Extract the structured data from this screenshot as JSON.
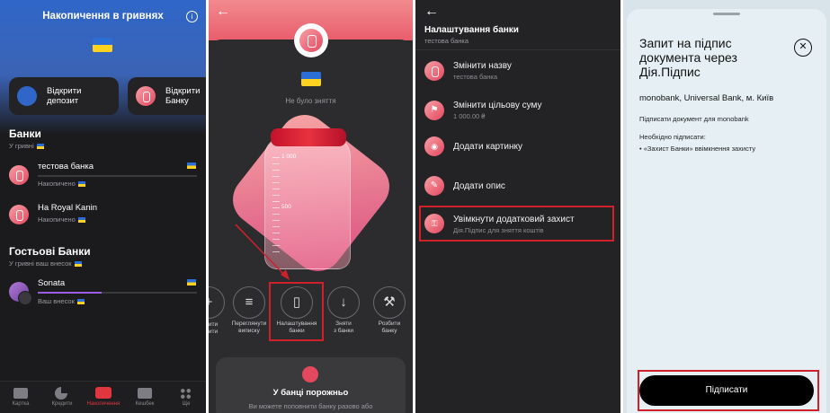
{
  "colors": {
    "accent_blue": "#2f66c8",
    "pink": "#e3485e",
    "red_highlight": "#d0202a",
    "dark": "#1b1b1d"
  },
  "screen1": {
    "header_title": "Накопичення в гривнях",
    "info_icon": "info-icon",
    "actions": [
      {
        "label": "Відкрити депозит",
        "icon": "deposit-icon"
      },
      {
        "label": "Відкрити Банку",
        "icon": "jar-icon"
      }
    ],
    "banks_title": "Банки",
    "banks_subtitle": "У гривні",
    "banks": [
      {
        "name": "тестова банка",
        "status": "Накопичено"
      },
      {
        "name": "На Royal Kanin",
        "status": "Накопичено"
      }
    ],
    "guest_title": "Гостьові Банки",
    "guest_subtitle": "У гривні ваш внесок",
    "guest_banks": [
      {
        "name": "Sonata",
        "status": "Ваш внесок",
        "progress": 0.4
      }
    ],
    "bottom_nav": [
      {
        "label": "Картка",
        "icon": "card-icon"
      },
      {
        "label": "Кредити",
        "icon": "pie-chart-icon"
      },
      {
        "label": "Накопичення",
        "icon": "savings-icon",
        "active": true
      },
      {
        "label": "Кешбек",
        "icon": "gift-icon"
      },
      {
        "label": "Ще",
        "icon": "more-icon"
      }
    ]
  },
  "screen2": {
    "back_icon": "back-arrow-icon",
    "status_text": "Не було зняття",
    "jar_marks": [
      "1 000",
      "500"
    ],
    "actions": [
      {
        "label": "ити\nити",
        "icon": "partial-icon"
      },
      {
        "label": "Переглянути\nвиписку",
        "icon": "list-icon"
      },
      {
        "label": "Налаштування\nбанки",
        "icon": "jar-settings-icon"
      },
      {
        "label": "Зняти\nз банки",
        "icon": "arrow-down-icon"
      },
      {
        "label": "Розбити\nбанку",
        "icon": "hammer-icon"
      }
    ],
    "empty_title": "У банці порожньо",
    "empty_text": "Ви можете поповнити банку разово або"
  },
  "screen3": {
    "back_icon": "back-arrow-icon",
    "title": "Налаштування банки",
    "subtitle": "тестова банка",
    "items": [
      {
        "title": "Змінити назву",
        "sub": "тестова банка",
        "icon": "jar-icon"
      },
      {
        "title": "Змінити цільову суму",
        "sub": "1 000.00 ₴",
        "icon": "target-icon"
      },
      {
        "title": "Додати картинку",
        "sub": "",
        "icon": "camera-icon"
      },
      {
        "title": "Додати опис",
        "sub": "",
        "icon": "pencil-icon"
      },
      {
        "title": "Увімкнути додатковий захист",
        "sub": "Дія.Підпис для зняття коштів",
        "icon": "shield-key-icon"
      }
    ]
  },
  "screen4": {
    "title": "Запит на підпис документа через Дія.Підпис",
    "org": "monobank, Universal Bank, м. Київ",
    "doc_line": "Підписати документ для monobank",
    "need_label": "Необхідно підписати:",
    "need_item": "• «Захист Банки» ввімкнення захисту",
    "sign_button": "Підписати",
    "close_icon": "close-icon"
  }
}
